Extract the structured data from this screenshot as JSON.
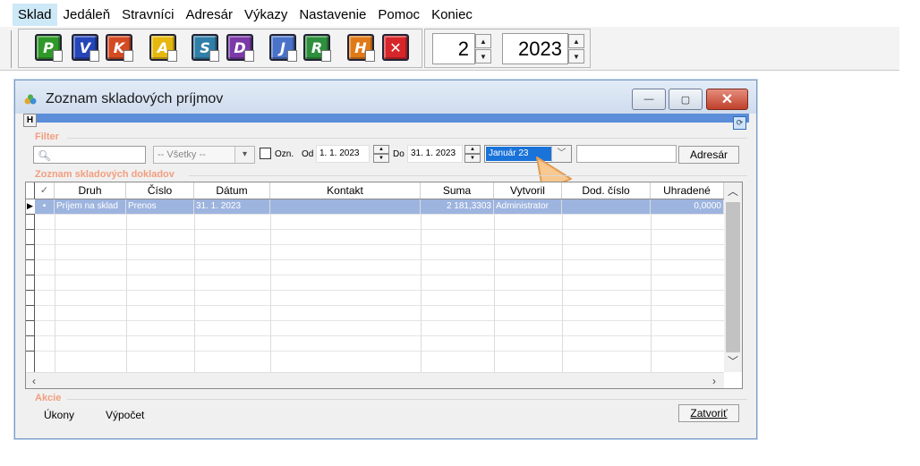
{
  "menu": {
    "items": [
      "Sklad",
      "Jedáleň",
      "Stravníci",
      "Adresár",
      "Výkazy",
      "Nastavenie",
      "Pomoc",
      "Koniec"
    ]
  },
  "toolbar": {
    "buttons": [
      {
        "letter": "P",
        "color": "#2f9a2a"
      },
      {
        "letter": "V",
        "color": "#2546b8"
      },
      {
        "letter": "K",
        "color": "#d34b23"
      },
      {
        "letter": "A",
        "color": "#e6b80f"
      },
      {
        "letter": "S",
        "color": "#2f7fa8"
      },
      {
        "letter": "D",
        "color": "#7b3aa8"
      },
      {
        "letter": "J",
        "color": "#4a72c8"
      },
      {
        "letter": "R",
        "color": "#2e8f3c"
      },
      {
        "letter": "H",
        "color": "#e07a18"
      },
      {
        "letter": "✕",
        "color": "#d6262a"
      }
    ],
    "month_value": "2",
    "year_value": "2023"
  },
  "window": {
    "title": "Zoznam skladových príjmov",
    "h_label": "H"
  },
  "filter": {
    "section_label": "Filter",
    "search_placeholder": "",
    "category_value": "-- Všetky --",
    "ozn_label": "Ozn.",
    "od_label": "Od",
    "od_value": "1. 1. 2023",
    "do_label": "Do",
    "do_value": "31. 1. 2023",
    "period_value": "Január 23",
    "extra_value": "",
    "adresar_button": "Adresár"
  },
  "list": {
    "section_label": "Zoznam skladových dokladov",
    "columns": [
      "Druh",
      "Číslo",
      "Dátum",
      "Kontakt",
      "Suma",
      "Vytvoril",
      "Dod. číslo",
      "Uhradené"
    ],
    "rows": [
      {
        "druh": "Príjem na sklad",
        "cislo": "Prenos",
        "datum": "31. 1. 2023",
        "kontakt": "",
        "suma": "2 181,3303",
        "vytvoril": "Administrator",
        "dod_cislo": "",
        "uhradene": "0,0000"
      }
    ]
  },
  "actions": {
    "section_label": "Akcie",
    "ukony": "Úkony",
    "vypocet": "Výpočet",
    "zatvorit": "Zatvoriť"
  },
  "colors": {
    "accent_bar": "#5b8dd9",
    "section_label": "#f29e7f",
    "selected_row": "#9db4df",
    "period_highlight": "#1a73d9"
  }
}
